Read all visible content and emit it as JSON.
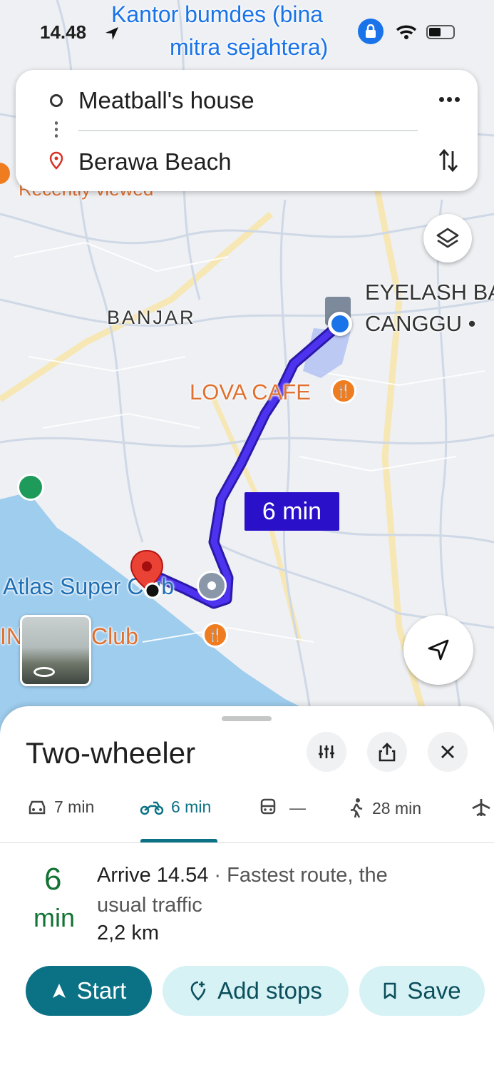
{
  "status_bar": {
    "time": "14.48"
  },
  "map": {
    "labels": {
      "kantor_line1": "Kantor bumdes (bina",
      "kantor_line2": "mitra sejahtera)",
      "recently_viewed": "Recently viewed",
      "banjar": "BANJAR",
      "eyelash_line1": "EYELASH BA",
      "eyelash_line2": "CANGGU •",
      "lova_cafe": "LOVA CAFE",
      "atlas": "Atlas Super Club",
      "beach_club": "IN    ach Club"
    },
    "route_time": "6 min",
    "colors": {
      "route": "#3b1fd6",
      "water": "#9fcdee",
      "origin": "#1a73e8",
      "destination": "#ea4335",
      "food_poi": "#f07c20",
      "park_poi": "#1e9a5a"
    }
  },
  "search": {
    "origin": "Meatball's house",
    "destination": "Berawa Beach",
    "more_icon": "more-horizontal-icon",
    "swap_icon": "swap-vertical-icon"
  },
  "sheet": {
    "title": "Two-wheeler",
    "modes": [
      {
        "name": "drive",
        "icon": "car-icon",
        "label": "7 min"
      },
      {
        "name": "two-wheeler",
        "icon": "motorbike-icon",
        "label": "6 min",
        "selected": true
      },
      {
        "name": "transit",
        "icon": "train-icon",
        "label": "—"
      },
      {
        "name": "walk",
        "icon": "walking-icon",
        "label": "28 min"
      },
      {
        "name": "flight",
        "icon": "airplane-icon",
        "label": ""
      }
    ],
    "duration_value": "6",
    "duration_unit": "min",
    "arrive": "Arrive 14.54",
    "route_note_1": " · Fastest route, the",
    "route_note_2": "usual traffic",
    "distance": "2,2 km",
    "buttons": {
      "start": "Start",
      "add_stops": "Add stops",
      "save": "Save"
    },
    "accent": "#0b7285"
  }
}
